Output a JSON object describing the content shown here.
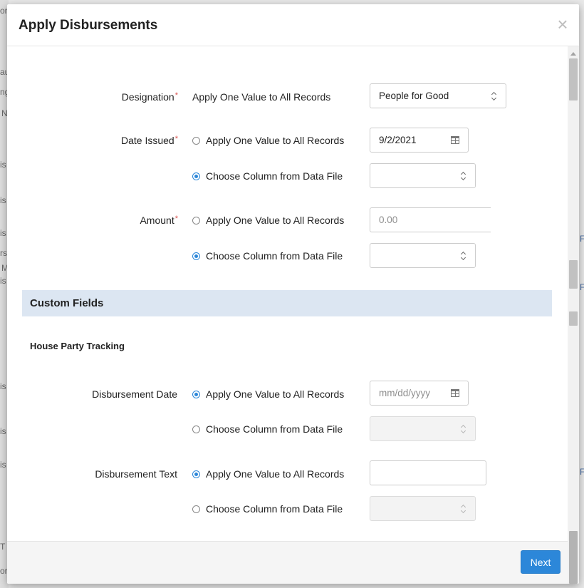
{
  "modal": {
    "title": "Apply Disbursements",
    "close_glyph": "×",
    "next_label": "Next"
  },
  "form": {
    "designation": {
      "label": "Designation",
      "required_mark": "*",
      "option_text": "Apply One Value to All Records",
      "value": "People for Good"
    },
    "date_issued": {
      "label": "Date Issued",
      "required_mark": "*",
      "option_apply": "Apply One Value to All Records",
      "option_column": "Choose Column from Data File",
      "selected": "column",
      "date_value": "9/2/2021",
      "column_value": ""
    },
    "amount": {
      "label": "Amount",
      "required_mark": "*",
      "option_apply": "Apply One Value to All Records",
      "option_column": "Choose Column from Data File",
      "selected": "column",
      "placeholder": "0.00",
      "column_value": ""
    }
  },
  "custom_fields": {
    "section_title": "Custom Fields",
    "group_title": "House Party Tracking",
    "disbursement_date": {
      "label": "Disbursement Date",
      "option_apply": "Apply One Value to All Records",
      "option_column": "Choose Column from Data File",
      "selected": "apply",
      "placeholder": "mm/dd/yyyy",
      "column_value": ""
    },
    "disbursement_text": {
      "label": "Disbursement Text",
      "option_apply": "Apply One Value to All Records",
      "option_column": "Choose Column from Data File",
      "selected": "apply",
      "value": "",
      "column_value": ""
    }
  },
  "background": {
    "fragments": [
      "or",
      "au",
      "ng",
      "N",
      "is",
      "is",
      "is",
      "rs",
      "M",
      "is",
      "is",
      "is",
      "is",
      "T",
      "or"
    ],
    "right_fragments": [
      "F",
      "F",
      "F"
    ]
  },
  "colors": {
    "primary": "#2c87d9",
    "required": "#d9534f",
    "section_bg": "#dce6f2"
  }
}
